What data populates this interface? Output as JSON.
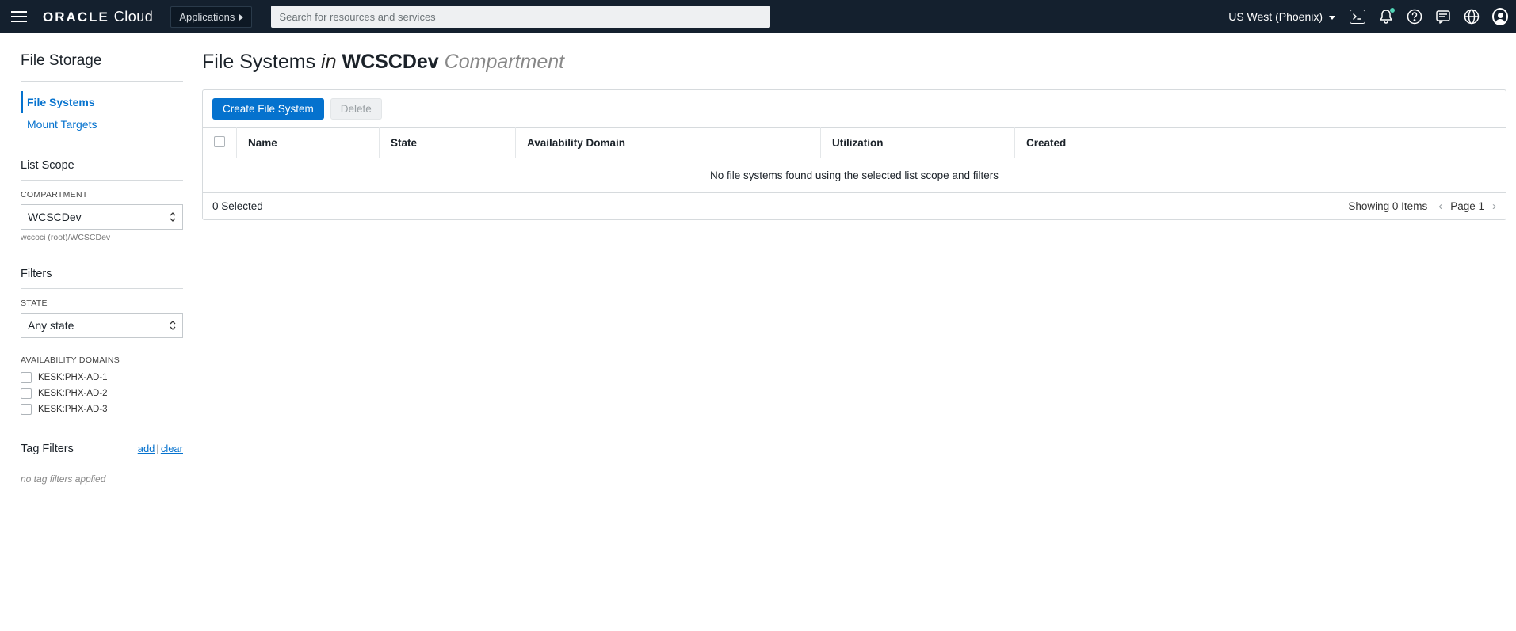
{
  "nav": {
    "brand_bold": "ORACLE",
    "brand_light": "Cloud",
    "applications_label": "Applications",
    "search_placeholder": "Search for resources and services",
    "region": "US West (Phoenix)"
  },
  "sidebar": {
    "title": "File Storage",
    "items": [
      {
        "label": "File Systems",
        "active": true
      },
      {
        "label": "Mount Targets",
        "active": false
      }
    ],
    "list_scope": {
      "heading": "List Scope",
      "compartment_label": "COMPARTMENT",
      "compartment_value": "WCSCDev",
      "compartment_breadcrumb": "wccoci (root)/WCSCDev"
    },
    "filters": {
      "heading": "Filters",
      "state_label": "STATE",
      "state_value": "Any state",
      "ad_label": "AVAILABILITY DOMAINS",
      "ad_options": [
        "KESK:PHX-AD-1",
        "KESK:PHX-AD-2",
        "KESK:PHX-AD-3"
      ]
    },
    "tag_filters": {
      "heading": "Tag Filters",
      "add": "add",
      "clear": "clear",
      "empty": "no tag filters applied"
    }
  },
  "main": {
    "title_resource": "File Systems",
    "title_in": "in",
    "title_compartment": "WCSCDev",
    "title_suffix": "Compartment",
    "actions": {
      "create": "Create File System",
      "delete": "Delete"
    },
    "columns": {
      "name": "Name",
      "state": "State",
      "ad": "Availability Domain",
      "util": "Utilization",
      "created": "Created"
    },
    "empty_message": "No file systems found using the selected list scope and filters",
    "footer": {
      "selected": "0 Selected",
      "showing": "Showing 0 Items",
      "page": "Page 1"
    }
  }
}
